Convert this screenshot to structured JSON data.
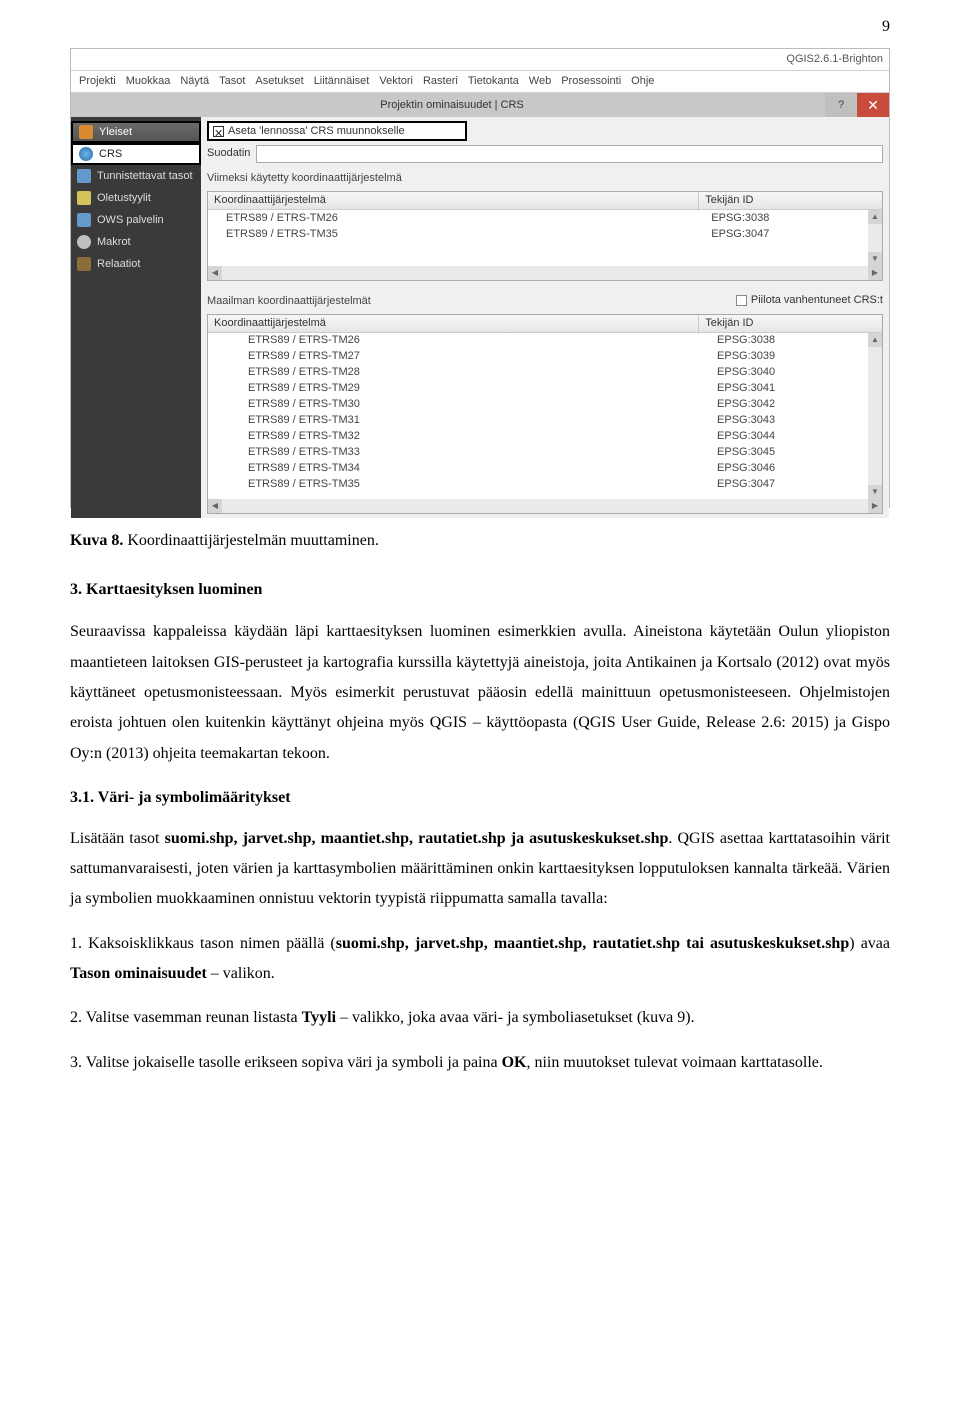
{
  "page_number": "9",
  "screenshot": {
    "window_title": "QGIS2.6.1-Brighton",
    "menu": [
      "Projekti",
      "Muokkaa",
      "Näytä",
      "Tasot",
      "Asetukset",
      "Liitännäiset",
      "Vektori",
      "Rasteri",
      "Tietokanta",
      "Web",
      "Prosessointi",
      "Ohje"
    ],
    "dialog_title": "Projektin ominaisuudet | CRS",
    "dlg_help": "?",
    "dlg_close": "✕",
    "sidebar": {
      "items": [
        {
          "label": "Yleiset"
        },
        {
          "label": "CRS"
        },
        {
          "label": "Tunnistettavat tasot"
        },
        {
          "label": "Oletustyylit"
        },
        {
          "label": "OWS palvelin"
        },
        {
          "label": "Makrot"
        },
        {
          "label": "Relaatiot"
        }
      ]
    },
    "checkbox_label": "Aseta 'lennossa' CRS muunnokselle",
    "filter_label": "Suodatin",
    "recent_label": "Viimeksi käytetty koordinaattijärjestelmä",
    "col_crs": "Koordinaattijärjestelmä",
    "col_id": "Tekijän ID",
    "recent_rows": [
      {
        "crs": "ETRS89 / ETRS-TM26",
        "id": "EPSG:3038"
      },
      {
        "crs": "ETRS89 / ETRS-TM35",
        "id": "EPSG:3047"
      }
    ],
    "world_label": "Maailman koordinaattijärjestelmät",
    "hide_label": "Piilota vanhentuneet CRS:t",
    "world_rows": [
      {
        "crs": "ETRS89 / ETRS-TM26",
        "id": "EPSG:3038"
      },
      {
        "crs": "ETRS89 / ETRS-TM27",
        "id": "EPSG:3039"
      },
      {
        "crs": "ETRS89 / ETRS-TM28",
        "id": "EPSG:3040"
      },
      {
        "crs": "ETRS89 / ETRS-TM29",
        "id": "EPSG:3041"
      },
      {
        "crs": "ETRS89 / ETRS-TM30",
        "id": "EPSG:3042"
      },
      {
        "crs": "ETRS89 / ETRS-TM31",
        "id": "EPSG:3043"
      },
      {
        "crs": "ETRS89 / ETRS-TM32",
        "id": "EPSG:3044"
      },
      {
        "crs": "ETRS89 / ETRS-TM33",
        "id": "EPSG:3045"
      },
      {
        "crs": "ETRS89 / ETRS-TM34",
        "id": "EPSG:3046"
      },
      {
        "crs": "ETRS89 / ETRS-TM35",
        "id": "EPSG:3047"
      }
    ]
  },
  "caption_b": "Kuva 8.",
  "caption_rest": " Koordinaattijärjestelmän muuttaminen.",
  "h2": "3. Karttaesityksen luominen",
  "p1": "Seuraavissa kappaleissa käydään läpi karttaesityksen luominen esimerkkien avulla. Aineistona käytetään Oulun yliopiston maantieteen laitoksen GIS-perusteet ja kartografia kurssilla käytettyjä aineistoja, joita Antikainen ja Kortsalo (2012) ovat myös käyttäneet opetusmonisteessaan. Myös esimerkit perustuvat pääosin edellä mainittuun opetusmonisteeseen. Ohjelmistojen eroista johtuen olen kuitenkin käyttänyt ohjeina myös QGIS – käyttöopasta (QGIS User Guide, Release 2.6: 2015) ja Gispo Oy:n (2013) ohjeita teemakartan tekoon.",
  "h3": "3.1. Väri- ja symbolimääritykset",
  "p2_a": "Lisätään tasot ",
  "p2_b": "suomi.shp, jarvet.shp, maantiet.shp, rautatiet.shp ja asutuskeskukset.shp",
  "p2_c": ". QGIS asettaa karttatasoihin värit sattumanvaraisesti, joten värien ja karttasymbolien määrittäminen onkin karttaesityksen lopputuloksen kannalta tärkeää. Värien ja symbolien muokkaaminen onnistuu vektorin tyypistä riippumatta samalla tavalla:",
  "p3_a": "1. Kaksoisklikkaus tason nimen päällä (",
  "p3_b": "suomi.shp, jarvet.shp, maantiet.shp, rautatiet.shp tai asutuskeskukset.shp",
  "p3_c": ") avaa ",
  "p3_d": "Tason ominaisuudet",
  "p3_e": " – valikon.",
  "p4_a": "2. Valitse vasemman reunan listasta ",
  "p4_b": "Tyyli",
  "p4_c": " – valikko, joka avaa väri- ja symboliasetukset (kuva 9).",
  "p5_a": "3. Valitse jokaiselle tasolle erikseen sopiva väri ja symboli ja paina ",
  "p5_b": "OK",
  "p5_c": ", niin muutokset tulevat voimaan karttatasolle."
}
